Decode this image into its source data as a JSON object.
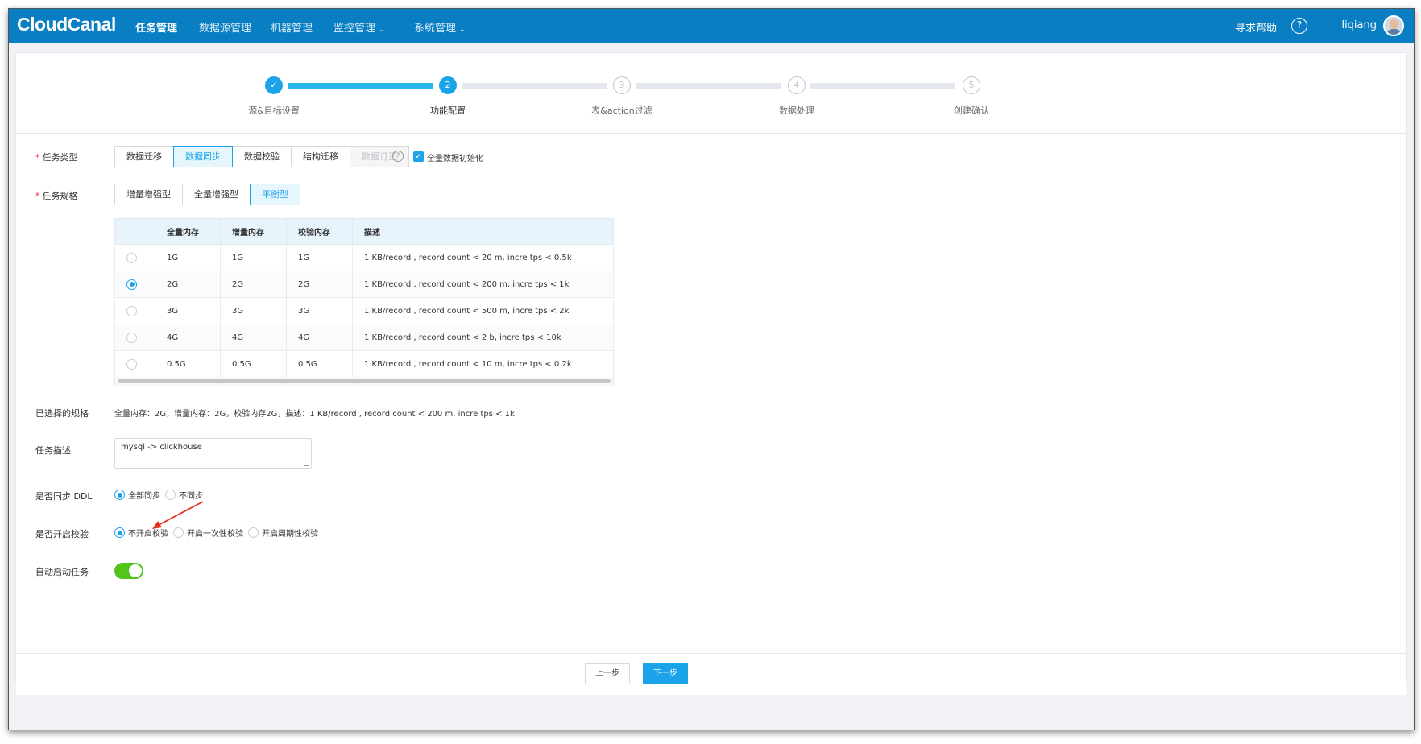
{
  "nav": {
    "logo": "CloudCanal",
    "items": [
      "任务管理",
      "数据源管理",
      "机器管理",
      "监控管理",
      "系统管理"
    ],
    "help": "寻求帮助",
    "user": "liqiang"
  },
  "steps": [
    {
      "label": "源&目标设置",
      "num": "✓",
      "state": "done"
    },
    {
      "label": "功能配置",
      "num": "2",
      "state": "active"
    },
    {
      "label": "表&action过滤",
      "num": "3",
      "state": "pending"
    },
    {
      "label": "数据处理",
      "num": "4",
      "state": "pending"
    },
    {
      "label": "创建确认",
      "num": "5",
      "state": "pending"
    }
  ],
  "form": {
    "task_type_label": "任务类型",
    "task_types": [
      "数据迁移",
      "数据同步",
      "数据校验",
      "结构迁移",
      "数据订正"
    ],
    "task_type_selected": "数据同步",
    "full_init_label": "全量数据初始化",
    "spec_label": "任务规格",
    "spec_types": [
      "增量增强型",
      "全量增强型",
      "平衡型"
    ],
    "spec_type_selected": "平衡型",
    "table": {
      "headers": [
        "全量内存",
        "增量内存",
        "校验内存",
        "描述"
      ],
      "rows": [
        [
          "1G",
          "1G",
          "1G",
          "1 KB/record , record count < 20 m, incre tps < 0.5k"
        ],
        [
          "2G",
          "2G",
          "2G",
          "1 KB/record , record count < 200 m, incre tps < 1k"
        ],
        [
          "3G",
          "3G",
          "3G",
          "1 KB/record , record count < 500 m, incre tps < 2k"
        ],
        [
          "4G",
          "4G",
          "4G",
          "1 KB/record , record count < 2 b, incre tps < 10k"
        ],
        [
          "0.5G",
          "0.5G",
          "0.5G",
          "1 KB/record , record count < 10 m, incre tps < 0.2k"
        ]
      ],
      "selected_row": 1
    },
    "selected_spec_label": "已选择的规格",
    "selected_spec_value": "全量内存：2G，增量内存：2G，校验内存2G，描述：1 KB/record , record count < 200 m, incre tps < 1k",
    "desc_label": "任务描述",
    "desc_value": "mysql -> clickhouse",
    "ddl_label": "是否同步 DDL",
    "ddl_options": [
      "全部同步",
      "不同步"
    ],
    "ddl_selected": 0,
    "check_label": "是否开启校验",
    "check_options": [
      "不开启校验",
      "开启一次性校验",
      "开启周期性校验"
    ],
    "check_selected": 0,
    "auto_start_label": "自动启动任务",
    "auto_start": true
  },
  "footer": {
    "prev": "上一步",
    "next": "下一步"
  },
  "colors": {
    "nav_bg": "#0a7ec2",
    "accent": "#1aa3e8",
    "toggle_on": "#52c41a",
    "required": "#f5222d",
    "annotation_arrow": "#e8321e"
  }
}
